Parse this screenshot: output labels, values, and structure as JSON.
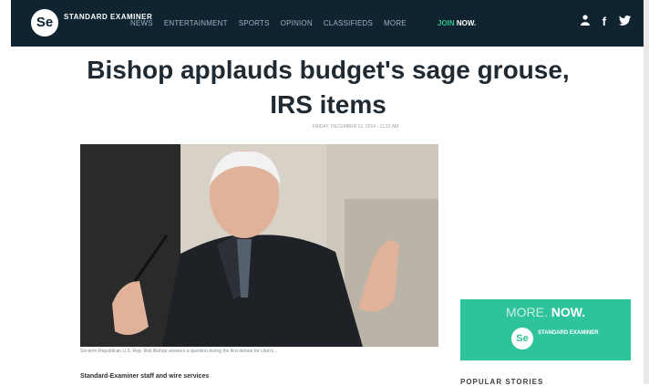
{
  "header": {
    "logo_text": "Se",
    "brand": "STANDARD EXAMINER",
    "nav": [
      "NEWS",
      "ENTERTAINMENT",
      "SPORTS",
      "OPINION",
      "CLASSIFIEDS",
      "MORE"
    ],
    "join": "JOIN",
    "now": "NOW.",
    "icons": [
      "user-icon",
      "facebook-icon",
      "twitter-icon"
    ]
  },
  "article": {
    "title": "Bishop applauds budget's sage grouse, IRS items",
    "date": "FRIDAY, DECEMBER 12, 2014 - 11:22 AM",
    "caption": "Six-term Republican U.S. Rep. Rob Bishop answers a question during the first debate for Utah's...",
    "author": "Standard-Examiner staff and wire services"
  },
  "promo": {
    "more": "MORE.",
    "now": "NOW.",
    "logo_text": "Se",
    "brand": "STANDARD EXAMINER"
  },
  "sidebar": {
    "popular": "POPULAR STORIES"
  },
  "colors": {
    "header_bg": "#0f2330",
    "accent": "#2ec39a"
  }
}
